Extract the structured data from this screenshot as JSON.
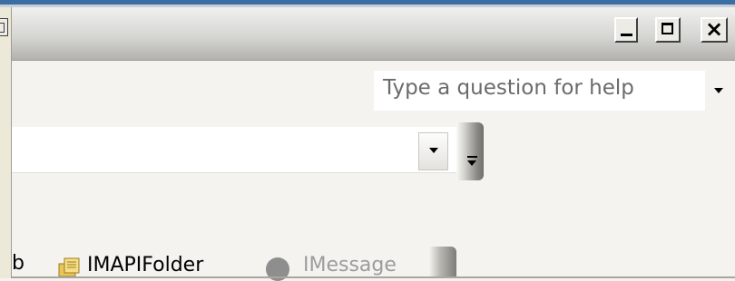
{
  "window": {
    "minimize_label": "_",
    "maximize_label": "□",
    "close_label": "×"
  },
  "help": {
    "placeholder": "Type a question for help"
  },
  "toolbar": {
    "partial_item": "b",
    "folder_label": "IMAPIFolder",
    "message_label": "IMessage"
  },
  "icons": {
    "left": "left-arrow-box-icon",
    "folder": "folder-icon",
    "message": "message-icon",
    "dropdown": "dropdown-arrow-icon"
  }
}
